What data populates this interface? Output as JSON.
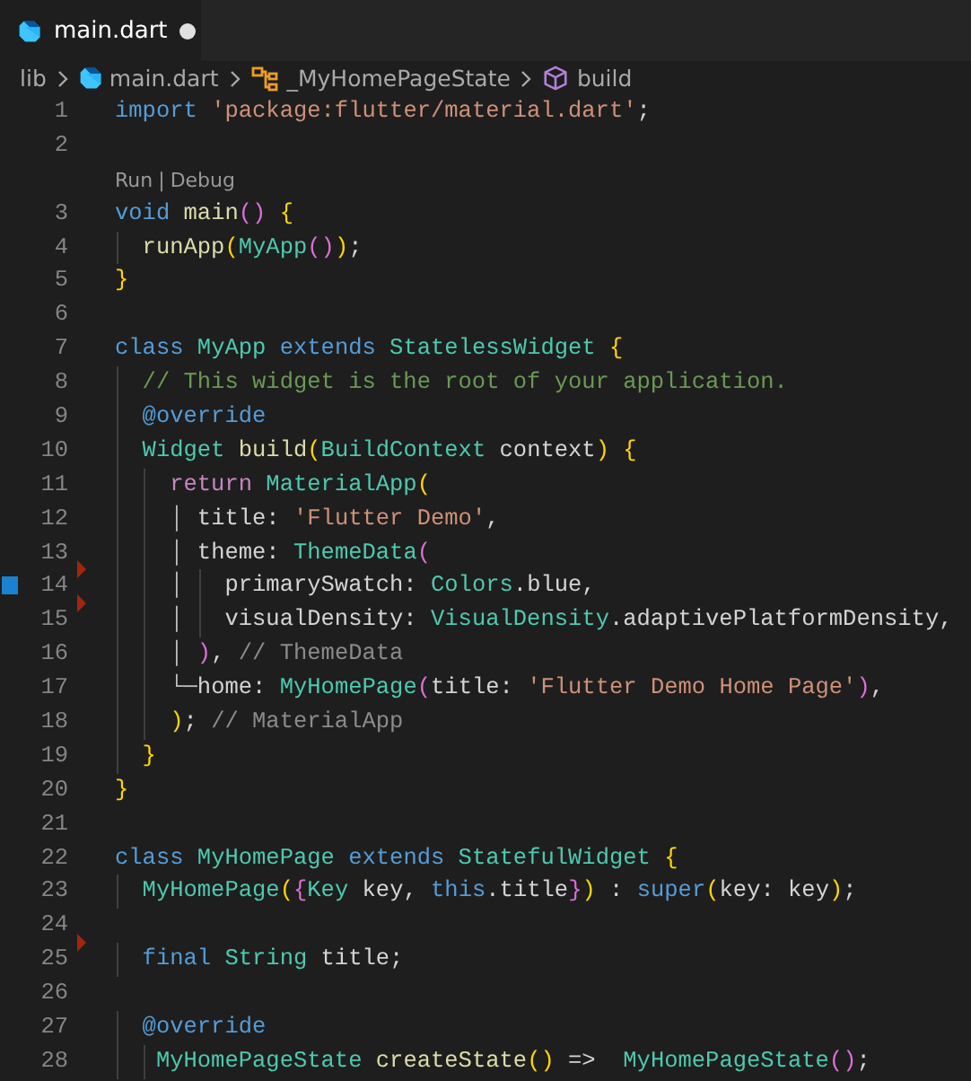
{
  "tab": {
    "label": "main.dart",
    "selected": true,
    "dirty": true
  },
  "breadcrumb": [
    {
      "label": "lib",
      "kind": "folder"
    },
    {
      "label": "main.dart",
      "kind": "file"
    },
    {
      "label": "_MyHomePageState",
      "kind": "class"
    },
    {
      "label": "build",
      "kind": "method"
    }
  ],
  "lines": [
    {
      "kind": "code",
      "num": "1",
      "tokens": [
        {
          "text": "import",
          "kind": "kw"
        },
        {
          "text": " 'package:flutter/material.dart'",
          "kind": "str"
        },
        {
          "text": ";",
          "kind": "def"
        }
      ]
    },
    {
      "kind": "code",
      "num": "2"
    },
    {
      "kind": "codelens",
      "links": [
        "Run",
        "Debug"
      ],
      "separator": "|"
    },
    {
      "kind": "code",
      "num": "3",
      "tokens": [
        {
          "text": "void",
          "kind": "kw"
        },
        {
          "text": " main",
          "kind": "func"
        },
        {
          "text": "()",
          "kind": "b2"
        },
        {
          "text": " {",
          "kind": "b1"
        }
      ]
    },
    {
      "kind": "code",
      "num": "4",
      "tokens": [
        {
          "text": "  runApp",
          "kind": "func"
        },
        {
          "text": "(",
          "kind": "b1"
        },
        {
          "text": "MyApp",
          "kind": "type"
        },
        {
          "text": "()",
          "kind": "b2"
        },
        {
          "text": ")",
          "kind": "b1"
        },
        {
          "text": ";",
          "kind": "def"
        }
      ]
    },
    {
      "kind": "code",
      "num": "5",
      "tokens": [
        {
          "text": "}",
          "kind": "b1"
        }
      ]
    },
    {
      "kind": "code",
      "num": "6"
    },
    {
      "kind": "code",
      "num": "7",
      "tokens": [
        {
          "text": "class",
          "kind": "kw"
        },
        {
          "text": " MyApp",
          "kind": "type"
        },
        {
          "text": " extends",
          "kind": "kw"
        },
        {
          "text": " StatelessWidget",
          "kind": "type"
        },
        {
          "text": " {",
          "kind": "b1"
        }
      ]
    },
    {
      "kind": "code",
      "num": "8",
      "tokens": [
        {
          "text": "  // This widget is the root of your application.",
          "kind": "comment"
        }
      ]
    },
    {
      "kind": "code",
      "num": "9",
      "tokens": [
        {
          "text": "  @override",
          "kind": "kw"
        }
      ]
    },
    {
      "kind": "code",
      "num": "10",
      "tokens": [
        {
          "text": "  Widget",
          "kind": "type"
        },
        {
          "text": " build",
          "kind": "func"
        },
        {
          "text": "(",
          "kind": "b1"
        },
        {
          "text": "BuildContext",
          "kind": "type"
        },
        {
          "text": " context",
          "kind": "def"
        },
        {
          "text": ")",
          "kind": "b1"
        },
        {
          "text": " {",
          "kind": "b1"
        }
      ]
    },
    {
      "kind": "code",
      "num": "11",
      "tokens": [
        {
          "text": "    return",
          "kind": "ctrl"
        },
        {
          "text": " MaterialApp",
          "kind": "type"
        },
        {
          "text": "(",
          "kind": "b1"
        }
      ]
    },
    {
      "kind": "code",
      "num": "12",
      "tokens": [
        {
          "text": "    │",
          "kind": "guide"
        },
        {
          "text": " title: ",
          "kind": "def"
        },
        {
          "text": "'Flutter Demo'",
          "kind": "str"
        },
        {
          "text": ",",
          "kind": "def"
        }
      ]
    },
    {
      "kind": "code",
      "num": "13",
      "deleted_below": true,
      "tokens": [
        {
          "text": "    │",
          "kind": "guide"
        },
        {
          "text": " theme: ",
          "kind": "def"
        },
        {
          "text": "ThemeData",
          "kind": "type"
        },
        {
          "text": "(",
          "kind": "b2"
        }
      ]
    },
    {
      "kind": "code",
      "num": "14",
      "modified": true,
      "deleted_below": true,
      "tokens": [
        {
          "text": "    │",
          "kind": "guide"
        },
        {
          "text": "   primarySwatch: ",
          "kind": "def"
        },
        {
          "text": "Colors",
          "kind": "type"
        },
        {
          "text": ".blue,",
          "kind": "def"
        }
      ]
    },
    {
      "kind": "code",
      "num": "15",
      "tokens": [
        {
          "text": "    │",
          "kind": "guide"
        },
        {
          "text": "   visualDensity: ",
          "kind": "def"
        },
        {
          "text": "VisualDensity",
          "kind": "type"
        },
        {
          "text": ".adaptivePlatformDensity,",
          "kind": "def"
        }
      ]
    },
    {
      "kind": "code",
      "num": "16",
      "tokens": [
        {
          "text": "    │",
          "kind": "guide"
        },
        {
          "text": " )",
          "kind": "b2"
        },
        {
          "text": ",",
          "kind": "def"
        },
        {
          "text": " // ThemeData",
          "kind": "label"
        }
      ]
    },
    {
      "kind": "code",
      "num": "17",
      "tokens": [
        {
          "text": "    └─",
          "kind": "guide"
        },
        {
          "text": "home: ",
          "kind": "def"
        },
        {
          "text": "MyHomePage",
          "kind": "type"
        },
        {
          "text": "(",
          "kind": "b2"
        },
        {
          "text": "title: ",
          "kind": "def"
        },
        {
          "text": "'Flutter Demo Home Page'",
          "kind": "str"
        },
        {
          "text": ")",
          "kind": "b2"
        },
        {
          "text": ",",
          "kind": "def"
        }
      ]
    },
    {
      "kind": "code",
      "num": "18",
      "tokens": [
        {
          "text": "    )",
          "kind": "b1"
        },
        {
          "text": ";",
          "kind": "def"
        },
        {
          "text": " // MaterialApp",
          "kind": "label"
        }
      ]
    },
    {
      "kind": "code",
      "num": "19",
      "tokens": [
        {
          "text": "  }",
          "kind": "b1"
        }
      ]
    },
    {
      "kind": "code",
      "num": "20",
      "tokens": [
        {
          "text": "}",
          "kind": "b1"
        }
      ]
    },
    {
      "kind": "code",
      "num": "21"
    },
    {
      "kind": "code",
      "num": "22",
      "tokens": [
        {
          "text": "class",
          "kind": "kw"
        },
        {
          "text": " MyHomePage",
          "kind": "type"
        },
        {
          "text": " extends",
          "kind": "kw"
        },
        {
          "text": " StatefulWidget",
          "kind": "type"
        },
        {
          "text": " {",
          "kind": "b1"
        }
      ]
    },
    {
      "kind": "code",
      "num": "23",
      "tokens": [
        {
          "text": "  MyHomePage",
          "kind": "type"
        },
        {
          "text": "(",
          "kind": "b1"
        },
        {
          "text": "{",
          "kind": "b2"
        },
        {
          "text": "Key",
          "kind": "type"
        },
        {
          "text": " key, ",
          "kind": "def"
        },
        {
          "text": "this",
          "kind": "kw"
        },
        {
          "text": ".title",
          "kind": "def"
        },
        {
          "text": "}",
          "kind": "b2"
        },
        {
          "text": ")",
          "kind": "b1"
        },
        {
          "text": " : ",
          "kind": "def"
        },
        {
          "text": "super",
          "kind": "kw"
        },
        {
          "text": "(",
          "kind": "b1"
        },
        {
          "text": "key: key",
          "kind": "def"
        },
        {
          "text": ")",
          "kind": "b1"
        },
        {
          "text": ";",
          "kind": "def"
        }
      ]
    },
    {
      "kind": "code",
      "num": "24",
      "deleted_below": true
    },
    {
      "kind": "code",
      "num": "25",
      "tokens": [
        {
          "text": "  final",
          "kind": "kw"
        },
        {
          "text": " String",
          "kind": "type"
        },
        {
          "text": " title;",
          "kind": "def"
        }
      ]
    },
    {
      "kind": "code",
      "num": "26"
    },
    {
      "kind": "code",
      "num": "27",
      "tokens": [
        {
          "text": "  @override",
          "kind": "kw"
        }
      ]
    },
    {
      "kind": "code",
      "num": "28",
      "tokens": [
        {
          "text": "   MyHomePageState",
          "kind": "type"
        },
        {
          "text": " createState",
          "kind": "func"
        },
        {
          "text": "()",
          "kind": "b1"
        },
        {
          "text": " =>  ",
          "kind": "def"
        },
        {
          "text": "MyHomePageState",
          "kind": "type"
        },
        {
          "text": "()",
          "kind": "b2"
        },
        {
          "text": ";",
          "kind": "def"
        }
      ]
    }
  ]
}
